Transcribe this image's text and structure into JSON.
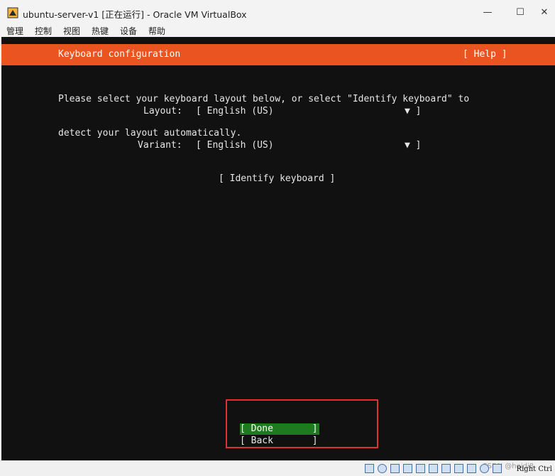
{
  "window": {
    "title": "ubuntu-server-v1 [正在运行] - Oracle VM VirtualBox",
    "minimize_icon": "—",
    "maximize_icon": "☐",
    "close_icon": "✕"
  },
  "menu": [
    "管理",
    "控制",
    "视图",
    "热键",
    "设备",
    "帮助"
  ],
  "installer": {
    "header_title": "Keyboard configuration",
    "help_label": "[ Help ]",
    "description_line1": "Please select your keyboard layout below, or select \"Identify keyboard\" to",
    "description_line2": "detect your layout automatically.",
    "layout_label": "Layout:",
    "layout_value": "[ English (US)",
    "variant_label": "Variant:",
    "variant_value": "[ English (US)",
    "dropdown_arrow": "▼ ]",
    "identify_button": "[ Identify keyboard ]",
    "done_button": "[ Done       ]",
    "back_button": "[ Back       ]"
  },
  "statusbar": {
    "watermark": "CSDN @haidi8",
    "host_key": "Right Ctrl"
  },
  "colors": {
    "header_accent": "#e95420",
    "done_button_bg": "#1e7a1e",
    "annotation_box": "#e03030"
  }
}
